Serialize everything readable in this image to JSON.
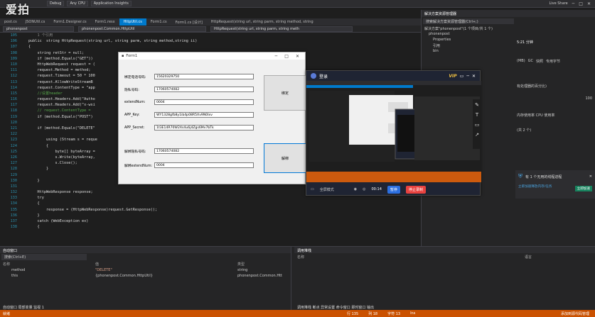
{
  "watermark": "爱拍",
  "toolbar": {
    "config": "Debug",
    "cpu": "Any CPU",
    "insights": "Application Insights",
    "live_share": "Live Share"
  },
  "tabs": [
    {
      "label": "post.cs"
    },
    {
      "label": "JSONUtil.cs"
    },
    {
      "label": "Form1.Designer.cs"
    },
    {
      "label": "Form1.resx"
    },
    {
      "label": "HttpUtil.cs"
    },
    {
      "label": "Form1.cs"
    },
    {
      "label": "Form1.cs [设计]"
    },
    {
      "label": "HttpRequest(string url, string parm, string method, string"
    }
  ],
  "nav": {
    "project": "phonenpost",
    "class": "phonenpost.Common.HttpUtil",
    "method": "HttpRequest(string url, string parm, string meth"
  },
  "line_numbers": [
    "105",
    "106",
    "107",
    "108",
    "109",
    "110",
    "111",
    "112",
    "113",
    "114",
    "115",
    "116",
    "117",
    "118",
    "119",
    "120",
    "121",
    "122",
    "123",
    "124",
    "125",
    "126",
    "127",
    "128",
    "129",
    "130",
    "131",
    "132",
    "133",
    "134",
    "135",
    "136",
    "137",
    "138"
  ],
  "code": [
    "    1 个引用",
    "public  string HttpRequest(string url, string parm, string method,string ii)",
    "{",
    "    string retStr = null;",
    "    if (method.Equals(\"GET\"))",
    "    HttpWebRequest request = (",
    "    request.Method = method;",
    "    request.Timeout = 50 * 100",
    "    request.AllowWriteStreamB",
    "    request.ContentType = \"app",
    "    //设置header",
    "    request.Headers.Add(\"Autho",
    "    request.Headers.Add(\"x-wsi",
    "    // request.ContentType =",
    "    if (method.Equals(\"POST\")",
    "",
    "    if (method.Equals(\"DELETE\"",
    "",
    "        using (Stream s = reque",
    "        {",
    "            byte[] byteArray =",
    "            s.Write(byteArray,",
    "            s.Close();",
    "        }",
    "",
    "    }",
    "",
    "    HttpWebResponse response;",
    "    try",
    "    {",
    "        response = (HttpWebResponse)request.GetResponse();",
    "    }",
    "    catch (WebException ex)",
    "    {"
  ],
  "form": {
    "title": "Form1",
    "fields": [
      {
        "label": "绑定电话号码:",
        "value": "15620329750"
      },
      {
        "label": "隐私号码:",
        "value": "17060574082"
      },
      {
        "label": "extendNum:",
        "value": "0004"
      },
      {
        "label": "APP_Key:",
        "value": "WY1328gfb8y1ib4p08R5Xv9N0Ixv"
      },
      {
        "label": "APP_Secret:",
        "value": "1t3E14R70W2Xs4u6j4Zgs6Mv7bTk"
      },
      {
        "label": "解绑隐私号码:",
        "value": "17060574082"
      },
      {
        "label": "解绑extendNum:",
        "value": "0004"
      }
    ],
    "bind_button": "绑定",
    "unbind_button": "解绑"
  },
  "recorder": {
    "title": "登录",
    "vip": "VIP",
    "mode": "全屏模式",
    "time": "00:14",
    "pause": "暂停",
    "stop": "停止录制"
  },
  "solution": {
    "header": "解决方案资源管理器",
    "search": "搜索解决方案资源管理器(Ctrl+;)",
    "items": [
      {
        "label": "解决方案\"phonenpost\"(1 个项目/共 1 个)"
      },
      {
        "label": "phonenpost"
      },
      {
        "label": "Properties"
      },
      {
        "label": "引用"
      },
      {
        "label": "bin"
      }
    ]
  },
  "diag": {
    "time": "5:21 分钟",
    "mem": "(MB)",
    "gc": "GC",
    "snapshot": "快照",
    "private": "专用字节",
    "cpu_pct": "有处理器的百分比)",
    "cpu_max": "100",
    "tabs": "内存使用率   CPU 使用率",
    "count": "(共 2 个)",
    "notice": "有 1 个无用的线程进程",
    "notice_sub": "立即加速释放内存/任务",
    "notice_btn": "立即加速"
  },
  "bottom": {
    "auto_header": "自动窗口",
    "search": "搜索(Ctrl+E)",
    "cols": [
      "名称",
      "值",
      "类型"
    ],
    "rows": [
      {
        "name": "method",
        "value": "\"DELETE\"",
        "type": "string"
      },
      {
        "name": "this",
        "value": "{phonenpost.Common.HttpUtil}",
        "type": "phonenpost.Common.Htt"
      }
    ],
    "callstack_header": "调用堆栈",
    "callstack_cols": [
      "名称",
      "语言"
    ],
    "left_tabs": "自动窗口  局部变量  监视 1",
    "right_tabs": "调用堆栈  断点  异常设置  命令窗口  即时窗口  输出"
  },
  "status": {
    "ready": "就绪",
    "row": "行 135",
    "col": "列 18",
    "char": "字符 13",
    "ins": "Ins",
    "source_control": "添加到源代码管理"
  },
  "colors": {
    "status_bar": "#ca5100",
    "active_tab": "#007acc"
  }
}
